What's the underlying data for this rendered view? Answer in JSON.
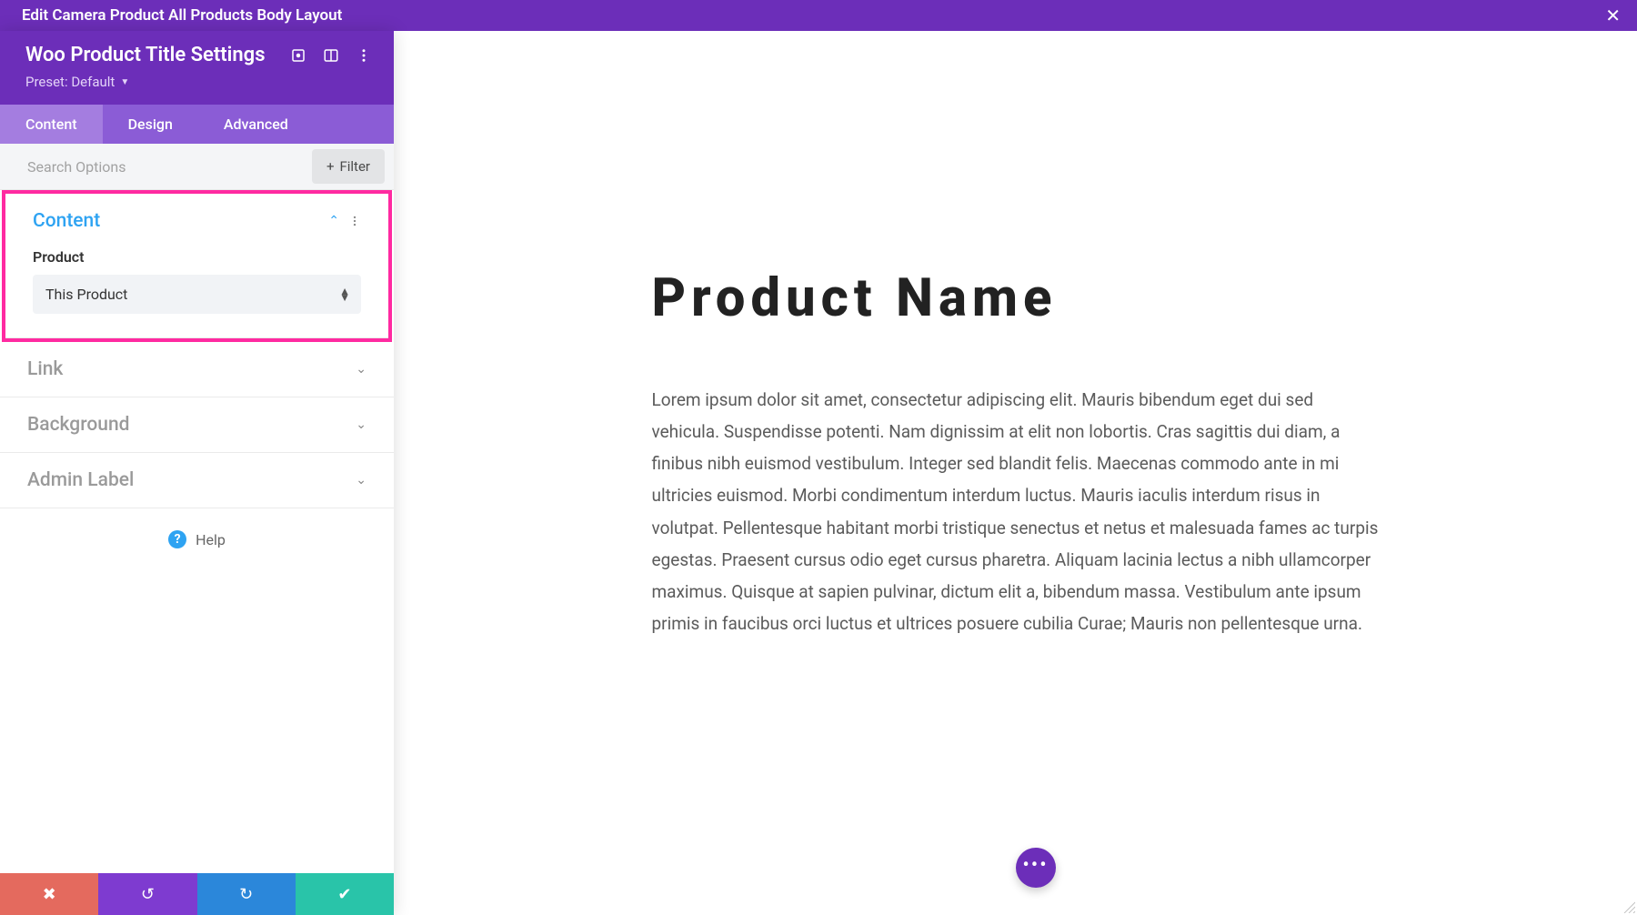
{
  "topbar": {
    "title": "Edit Camera Product All Products Body Layout"
  },
  "sidebar": {
    "title": "Woo Product Title Settings",
    "preset_label": "Preset: Default",
    "tabs": [
      "Content",
      "Design",
      "Advanced"
    ],
    "active_tab": 0,
    "search_placeholder": "Search Options",
    "filter_label": "Filter",
    "sections": {
      "content": {
        "title": "Content",
        "open": true,
        "product_label": "Product",
        "product_value": "This Product"
      },
      "link": {
        "title": "Link"
      },
      "background": {
        "title": "Background"
      },
      "admin_label": {
        "title": "Admin Label"
      }
    },
    "help_label": "Help"
  },
  "preview": {
    "heading": "Product Name",
    "body": "Lorem ipsum dolor sit amet, consectetur adipiscing elit. Mauris bibendum eget dui sed vehicula. Suspendisse potenti. Nam dignissim at elit non lobortis. Cras sagittis dui diam, a finibus nibh euismod vestibulum. Integer sed blandit felis. Maecenas commodo ante in mi ultricies euismod. Morbi condimentum interdum luctus. Mauris iaculis interdum risus in volutpat. Pellentesque habitant morbi tristique senectus et netus et malesuada fames ac turpis egestas. Praesent cursus odio eget cursus pharetra. Aliquam lacinia lectus a nibh ullamcorper maximus. Quisque at sapien pulvinar, dictum elit a, bibendum massa. Vestibulum ante ipsum primis in faucibus orci luctus et ultrices posuere cubilia Curae; Mauris non pellentesque urna."
  }
}
